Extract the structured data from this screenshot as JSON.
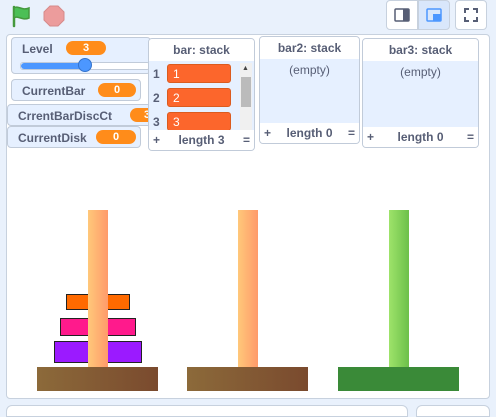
{
  "toolbar": {
    "green_flag_icon": "green-flag-icon",
    "stop_icon": "stop-icon",
    "small_stage_icon": "small-stage-icon",
    "large_stage_icon": "large-stage-icon",
    "fullscreen_icon": "fullscreen-icon"
  },
  "variables": {
    "level": {
      "name": "Level",
      "value": "3",
      "slider_fraction": 0.5
    },
    "current_bar": {
      "name": "CurrentBar",
      "value": "0"
    },
    "current_bar_disc_ct": {
      "name": "CrrentBarDiscCt",
      "value": "3"
    },
    "current_disk": {
      "name": "CurrentDisk",
      "value": "0"
    }
  },
  "lists": {
    "bar": {
      "title": "bar: stack",
      "items": [
        "1",
        "2",
        "3"
      ],
      "indices": [
        "1",
        "2",
        "3"
      ],
      "length_label": "length 3",
      "plus": "+",
      "eq": "="
    },
    "bar2": {
      "title": "bar2: stack",
      "empty_label": "(empty)",
      "length_label": "length 0",
      "plus": "+",
      "eq": "="
    },
    "bar3": {
      "title": "bar3: stack",
      "empty_label": "(empty)",
      "length_label": "length 0",
      "plus": "+",
      "eq": "="
    }
  },
  "colors": {
    "disk1": "#ff6a00",
    "disk2": "#ff1a8c",
    "disk3": "#9b1aff",
    "accent": "#ff8c1a",
    "list_item": "#fc662c"
  }
}
